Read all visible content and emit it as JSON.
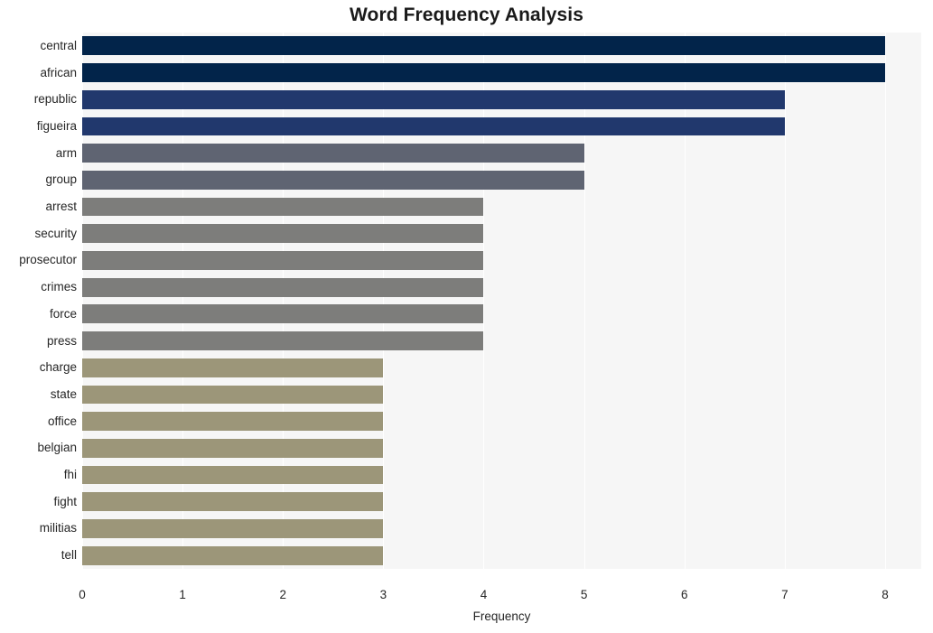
{
  "chart_data": {
    "type": "bar",
    "orientation": "horizontal",
    "title": "Word Frequency Analysis",
    "xlabel": "Frequency",
    "ylabel": "",
    "categories": [
      "central",
      "african",
      "republic",
      "figueira",
      "arm",
      "group",
      "arrest",
      "security",
      "prosecutor",
      "crimes",
      "force",
      "press",
      "charge",
      "state",
      "office",
      "belgian",
      "fhi",
      "fight",
      "militias",
      "tell"
    ],
    "values": [
      8,
      8,
      7,
      7,
      5,
      5,
      4,
      4,
      4,
      4,
      4,
      4,
      3,
      3,
      3,
      3,
      3,
      3,
      3,
      3
    ],
    "bar_colors": [
      "#02244a",
      "#02244a",
      "#21386d",
      "#21386d",
      "#5f6472",
      "#5f6472",
      "#7d7d7b",
      "#7d7d7b",
      "#7d7d7b",
      "#7d7d7b",
      "#7d7d7b",
      "#7d7d7b",
      "#9c9679",
      "#9c9679",
      "#9c9679",
      "#9c9679",
      "#9c9679",
      "#9c9679",
      "#9c9679",
      "#9c9679"
    ],
    "xlim": [
      0,
      8.36
    ],
    "x_ticks": [
      0,
      1,
      2,
      3,
      4,
      5,
      6,
      7,
      8
    ],
    "x_tick_labels": [
      "0",
      "1",
      "2",
      "3",
      "4",
      "5",
      "6",
      "7",
      "8"
    ],
    "grid": true,
    "grid_axis": "x",
    "grid_color": "#ffffff",
    "plot_background": "#f6f6f6",
    "figure_background": "#ffffff",
    "legend": null
  }
}
